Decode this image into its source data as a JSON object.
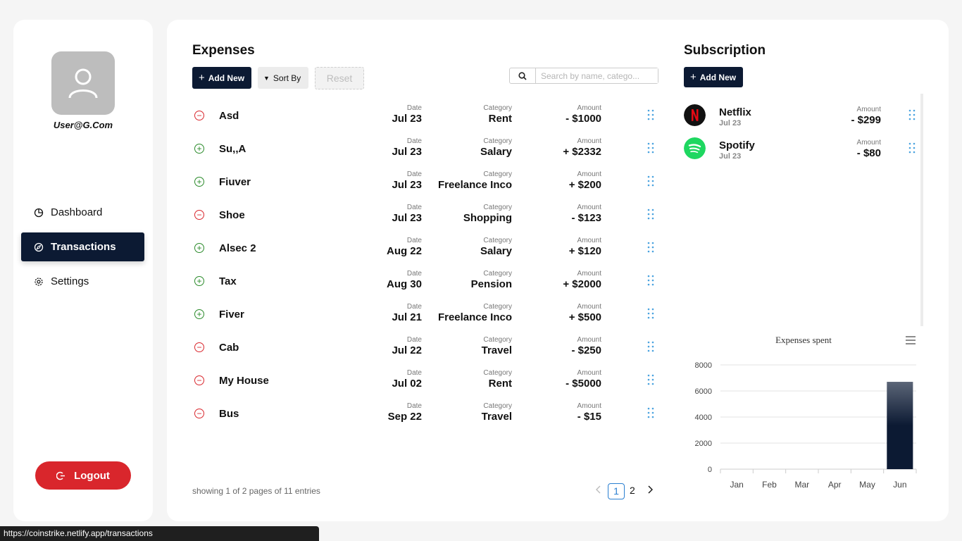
{
  "sidebar": {
    "user_email": "User@G.Com",
    "nav": [
      {
        "label": "Dashboard",
        "icon": "pie-chart-icon"
      },
      {
        "label": "Transactions",
        "icon": "compass-icon"
      },
      {
        "label": "Settings",
        "icon": "gear-icon"
      }
    ],
    "logout_label": "Logout"
  },
  "expenses": {
    "title": "Expenses",
    "add_new_label": "Add New",
    "sort_label": "Sort By",
    "reset_label": "Reset",
    "search_placeholder": "Search by name, catego...",
    "date_label": "Date",
    "category_label": "Category",
    "amount_label": "Amount",
    "rows": [
      {
        "type": "minus",
        "name": "Asd",
        "date": "Jul 23",
        "category": "Rent",
        "amount": "- $1000"
      },
      {
        "type": "plus",
        "name": "Su,,A",
        "date": "Jul 23",
        "category": "Salary",
        "amount": "+ $2332"
      },
      {
        "type": "plus",
        "name": "Fiuver",
        "date": "Jul 23",
        "category": "Freelance Inco",
        "amount": "+ $200"
      },
      {
        "type": "minus",
        "name": "Shoe",
        "date": "Jul 23",
        "category": "Shopping",
        "amount": "- $123"
      },
      {
        "type": "plus",
        "name": "Alsec 2",
        "date": "Aug 22",
        "category": "Salary",
        "amount": "+ $120"
      },
      {
        "type": "plus",
        "name": "Tax",
        "date": "Aug 30",
        "category": "Pension",
        "amount": "+ $2000"
      },
      {
        "type": "plus",
        "name": "Fiver",
        "date": "Jul 21",
        "category": "Freelance Inco",
        "amount": "+ $500"
      },
      {
        "type": "minus",
        "name": "Cab",
        "date": "Jul 22",
        "category": "Travel",
        "amount": "- $250"
      },
      {
        "type": "minus",
        "name": "My House",
        "date": "Jul 02",
        "category": "Rent",
        "amount": "- $5000"
      },
      {
        "type": "minus",
        "name": "Bus",
        "date": "Sep 22",
        "category": "Travel",
        "amount": "- $15"
      }
    ],
    "footer_text": "showing 1 of 2 pages of 11 entries",
    "pages": [
      "1",
      "2"
    ],
    "current_page": "1"
  },
  "subscription": {
    "title": "Subscription",
    "add_new_label": "Add New",
    "amount_label": "Amount",
    "items": [
      {
        "name": "Netflix",
        "date": "Jul 23",
        "amount": "- $299",
        "logo": "netflix-logo",
        "color": "#111111"
      },
      {
        "name": "Spotify",
        "date": "Jul 23",
        "amount": "- $80",
        "logo": "spotify-logo",
        "color": "#1ed760"
      }
    ]
  },
  "chart_data": {
    "type": "bar",
    "title": "Expenses spent",
    "categories": [
      "Jan",
      "Feb",
      "Mar",
      "Apr",
      "May",
      "Jun"
    ],
    "values": [
      0,
      0,
      0,
      0,
      0,
      6700
    ],
    "ylim": [
      0,
      8000
    ],
    "yticks": [
      0,
      2000,
      4000,
      6000,
      8000
    ],
    "xlabel": "",
    "ylabel": "",
    "grid": true,
    "bar_color": "#0c1a33"
  },
  "status_url": "https://coinstrike.netlify.app/transactions",
  "colors": {
    "navy": "#0c1a33",
    "danger": "#d9262c",
    "income": "#2a8a2a",
    "link": "#2a7fd1"
  }
}
